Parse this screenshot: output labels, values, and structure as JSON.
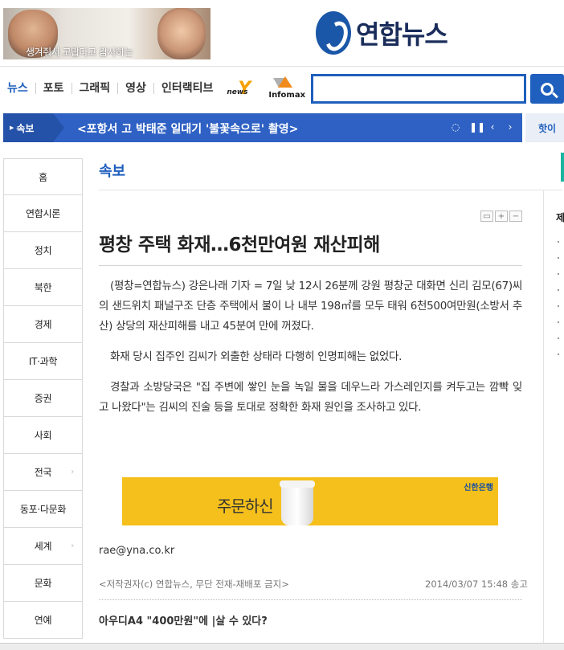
{
  "ad_banner": {
    "text": "생겨줘서 고맙다고 감사하는"
  },
  "logo": {
    "text": "연합뉴스"
  },
  "nav": {
    "items": [
      "뉴스",
      "포토",
      "그래픽",
      "영상",
      "인터랙티브"
    ],
    "news_y": {
      "mark": "Y",
      "label": "news"
    },
    "infomax": {
      "label": "Infomax"
    }
  },
  "search": {
    "value": ""
  },
  "breaking": {
    "tag": "속보",
    "headline": "<포항서 고 박태준 일대기 '불꽃속으로' 촬영>",
    "right_text": "핫이"
  },
  "sidebar": {
    "items": [
      {
        "label": "홈",
        "arrow": ""
      },
      {
        "label": "연합시론",
        "arrow": ""
      },
      {
        "label": "정치",
        "arrow": ""
      },
      {
        "label": "북한",
        "arrow": ""
      },
      {
        "label": "경제",
        "arrow": ""
      },
      {
        "label": "IT·과학",
        "arrow": ""
      },
      {
        "label": "증권",
        "arrow": ""
      },
      {
        "label": "사회",
        "arrow": ""
      },
      {
        "label": "전국",
        "arrow": "›"
      },
      {
        "label": "동포·다문화",
        "arrow": ""
      },
      {
        "label": "세계",
        "arrow": "›"
      },
      {
        "label": "문화",
        "arrow": ""
      },
      {
        "label": "연예",
        "arrow": ""
      }
    ]
  },
  "article": {
    "section": "속보",
    "title": "평창 주택 화재…6천만여원 재산피해",
    "paragraphs": [
      "(평창=연합뉴스) 강은나래 기자 = 7일 낮 12시 26분께 강원 평창군 대화면 신리 김모(67)씨의 샌드위치 패널구조 단층 주택에서 불이 나 내부 198㎡를 모두 태워 6천500여만원(소방서 추산) 상당의 재산피해를 내고 45분여 만에 꺼졌다.",
      "화재 당시 집주인 김씨가 외출한 상태라 다행히 인명피해는 없었다.",
      "경찰과 소방당국은 \"집 주변에 쌓인 눈을 녹일 물을 데우느라 가스레인지를 켜두고는 깜빡 잊고 나왔다\"는 김씨의 진술 등을 토대로 정확한 화재 원인을 조사하고 있다."
    ],
    "email": "rae@yna.co.kr",
    "copyright": "<저작권자(c) 연합뉴스, 무단 전재-재배포 금지>",
    "datetime": "2014/03/07 15:48 송고",
    "related": "아우디A4 \"400만원\"에 |살 수 있다?"
  },
  "ad2": {
    "text": "주문하신",
    "bank": "신한은행"
  },
  "right_column": {
    "label": "제"
  }
}
